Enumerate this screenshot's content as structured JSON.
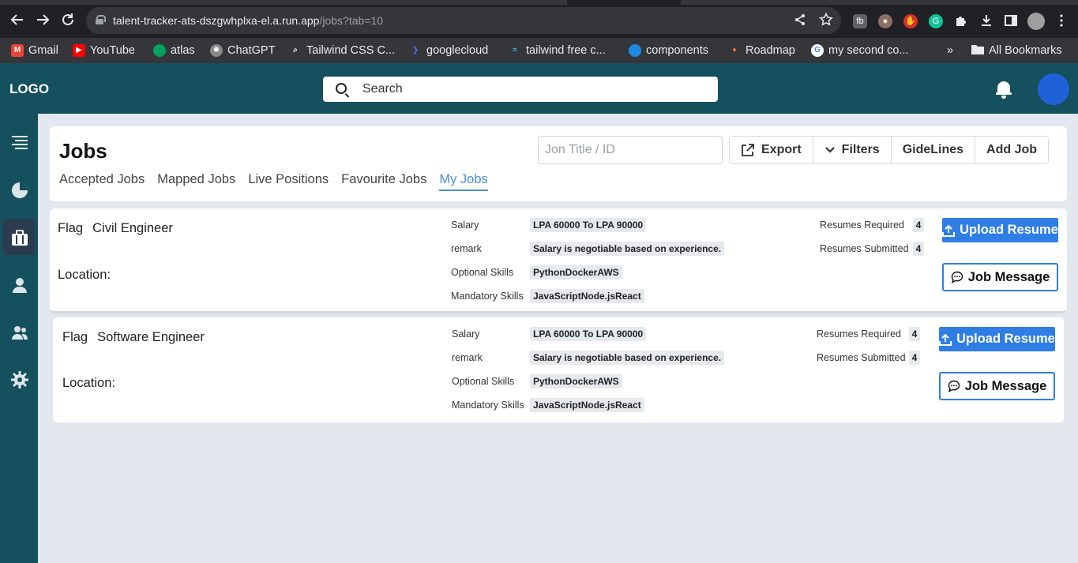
{
  "browser": {
    "url_host": "talent-tracker-ats-dszgwhplxa-el.a.run.app",
    "url_path": "/jobs?tab=10",
    "bookmarks": [
      {
        "label": "Gmail",
        "icon": "gmail-icon",
        "color": "#ea4335"
      },
      {
        "label": "YouTube",
        "icon": "youtube-icon",
        "color": "#ff0000"
      },
      {
        "label": "atlas",
        "icon": "atlas-icon",
        "color": "#00a35c"
      },
      {
        "label": "ChatGPT",
        "icon": "chatgpt-icon",
        "color": "#888888"
      },
      {
        "label": "Tailwind CSS C...",
        "icon": "tailwind-search-icon",
        "color": "#5f6368"
      },
      {
        "label": "googlecloud",
        "icon": "googlecloud-icon",
        "color": "#4a6cf7"
      },
      {
        "label": "tailwind free c...",
        "icon": "tailwind-icon",
        "color": "#38bdf8"
      },
      {
        "label": "components",
        "icon": "components-icon",
        "color": "#1e88e5"
      },
      {
        "label": "Roadmap",
        "icon": "roadmap-icon",
        "color": "#ff7043"
      },
      {
        "label": "my second co...",
        "icon": "google-icon",
        "color": "#4285f4"
      }
    ],
    "all_bookmarks": "All Bookmarks",
    "overflow": "»"
  },
  "header": {
    "logo": "LOGO",
    "search_placeholder": "Search"
  },
  "jobs": {
    "title": "Jobs",
    "search_placeholder": "Jon Title / ID",
    "actions": {
      "export": "Export",
      "filters": "Filters",
      "guidelines": "GideLines",
      "add_job": "Add Job"
    },
    "tabs": [
      {
        "label": "Accepted Jobs",
        "active": false
      },
      {
        "label": "Mapped Jobs",
        "active": false
      },
      {
        "label": "Live Positions",
        "active": false
      },
      {
        "label": "Favourite Jobs",
        "active": false
      },
      {
        "label": "My Jobs",
        "active": true
      }
    ]
  },
  "job_cards": [
    {
      "flag": "Flag",
      "title": "Civil Engineer",
      "location_label": "Location:",
      "salary_label": "Salary",
      "salary": "LPA 60000 To LPA 90000",
      "remark_label": "remark",
      "remark": "Salary is negotiable based on experience.",
      "optional_label": "Optional Skills",
      "optional": "PythonDockerAWS",
      "mandatory_label": "Mandatory Skills",
      "mandatory": "JavaScriptNode.jsReact",
      "resumes_required_label": "Resumes Required",
      "resumes_required": "4",
      "resumes_submitted_label": "Resumes Submitted",
      "resumes_submitted": "4",
      "upload_label": "Upload Resume",
      "message_label": "Job Message"
    },
    {
      "flag": "Flag",
      "title": "Software Engineer",
      "location_label": "Location:",
      "salary_label": "Salary",
      "salary": "LPA 60000 To LPA 90000",
      "remark_label": "remark",
      "remark": "Salary is negotiable based on experience.",
      "optional_label": "Optional Skills",
      "optional": "PythonDockerAWS",
      "mandatory_label": "Mandatory Skills",
      "mandatory": "JavaScriptNode.jsReact",
      "resumes_required_label": "Resumes Required",
      "resumes_required": "4",
      "resumes_submitted_label": "Resumes Submitted",
      "resumes_submitted": "4",
      "upload_label": "Upload Resume",
      "message_label": "Job Message"
    }
  ],
  "colors": {
    "header_bg": "#15505f",
    "accent": "#2f7ee6",
    "avatar": "#1f62d8",
    "page_bg": "#e3e8ef"
  }
}
